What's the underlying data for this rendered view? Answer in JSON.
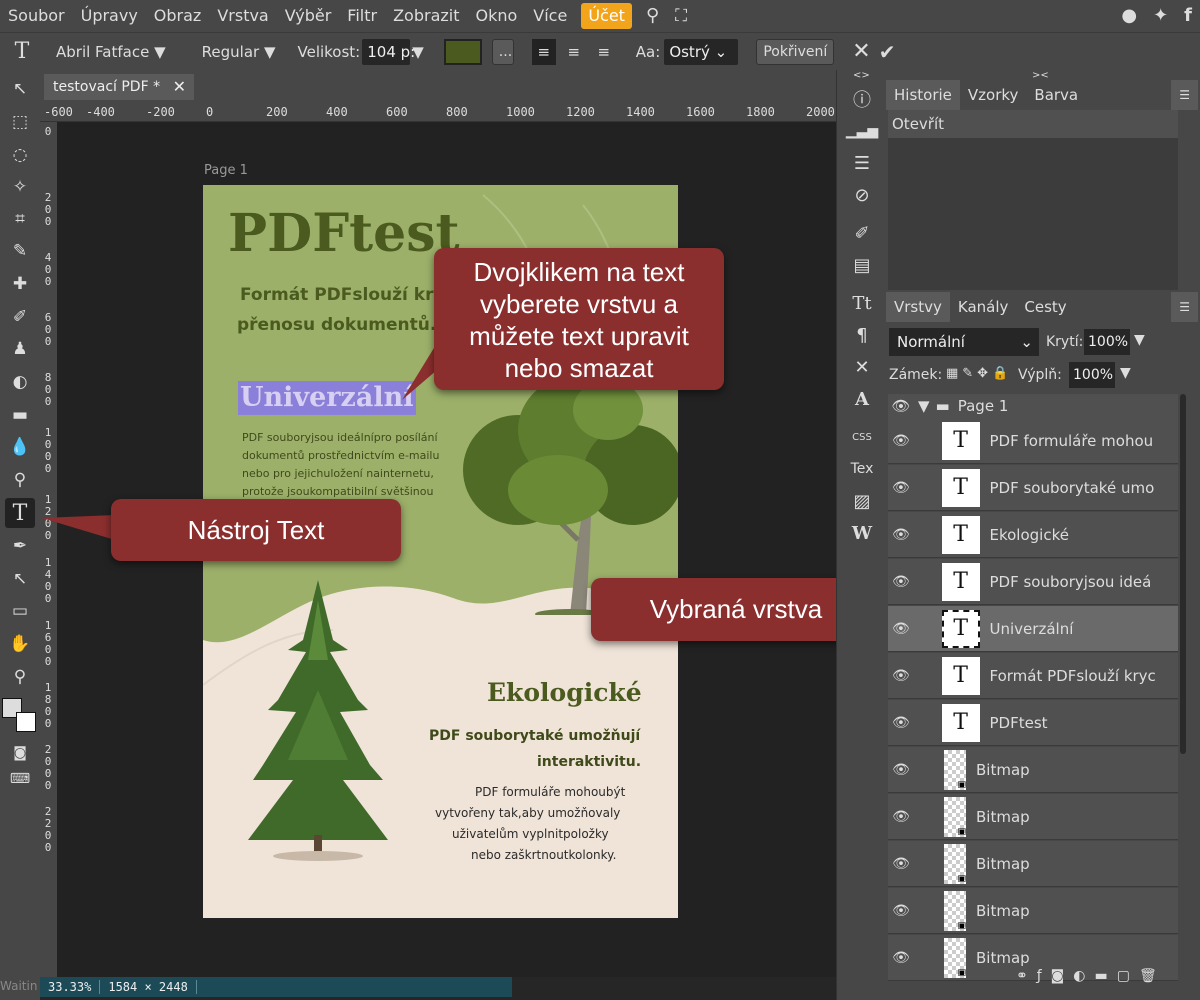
{
  "menu": {
    "items": [
      "Soubor",
      "Úpravy",
      "Obraz",
      "Vrstva",
      "Výběr",
      "Filtr",
      "Zobrazit",
      "Okno",
      "Více"
    ],
    "account": "Účet"
  },
  "options": {
    "font_family": "Abril Fatface",
    "font_style": "Regular",
    "size_label": "Velikost:",
    "size_value": "104 p:",
    "color": "#4b5a1e",
    "more": "...",
    "aa_label": "Aa:",
    "aa_value": "Ostrý",
    "advanced": "Pokřivení"
  },
  "document": {
    "tab_title": "testovací PDF *",
    "page_label": "Page 1"
  },
  "ruler": {
    "h": [
      "-600",
      "-400",
      "-200",
      "0",
      "200",
      "400",
      "600",
      "800",
      "1000",
      "1200",
      "1400",
      "1600",
      "1800",
      "2000"
    ],
    "v": [
      "0",
      "200",
      "400",
      "600",
      "800",
      "1000",
      "1200",
      "1400",
      "1600",
      "1800",
      "2000",
      "2200"
    ]
  },
  "page": {
    "title": "PDFtest",
    "subtitle_1": "Formát PDFslouží kryc",
    "subtitle_2": "přenosu dokumentů.",
    "selected_heading": "Univerzální",
    "body": [
      "PDF souboryjsou ideálnípro posílání",
      "dokumentů prostřednictvím e-mailu",
      "nebo pro jejichuložení nainternetu,",
      "protože jsoukompatibilní světšinou"
    ],
    "eco_heading": "Ekologické",
    "eco_sub_1": "PDF souborytaké umožňují",
    "eco_sub_2": "interaktivitu.",
    "eco_body": [
      "PDF formuláře mohoubýt",
      "vytvořeny tak,aby umožňovaly",
      "uživatelům vyplnitpoložky",
      "nebo zaškrtnoutkolonky."
    ]
  },
  "callouts": {
    "double_click_1": "Dvojklikem na text",
    "double_click_2": "vyberete vrstvu a",
    "double_click_3": "můžete text upravit",
    "double_click_4": "nebo smazat",
    "text_tool": "Nástroj Text",
    "selected_layer": "Vybraná vrstva"
  },
  "side_icons": {
    "css": "CSS",
    "tex": "Tex"
  },
  "history": {
    "tabs": [
      "Historie",
      "Vzorky",
      "Barva"
    ],
    "items": [
      "Otevřít"
    ]
  },
  "layers_panel": {
    "tabs": [
      "Vrstvy",
      "Kanály",
      "Cesty"
    ],
    "blend_mode": "Normální",
    "opacity_label": "Krytí:",
    "opacity_value": "100%",
    "lock_label": "Zámek:",
    "fill_label": "Výplň:",
    "fill_value": "100%",
    "group": "Page 1",
    "layers": [
      {
        "name": "PDF formuláře mohou",
        "type": "text",
        "selected": false
      },
      {
        "name": "PDF souborytaké umo",
        "type": "text",
        "selected": false
      },
      {
        "name": "Ekologické",
        "type": "text",
        "selected": false
      },
      {
        "name": "PDF souboryjsou ideá",
        "type": "text",
        "selected": false
      },
      {
        "name": "Univerzální",
        "type": "text",
        "selected": true
      },
      {
        "name": "Formát PDFslouží kryc",
        "type": "text",
        "selected": false
      },
      {
        "name": "PDFtest",
        "type": "text",
        "selected": false
      },
      {
        "name": "Bitmap",
        "type": "bitmap",
        "selected": false
      },
      {
        "name": "Bitmap",
        "type": "bitmap",
        "selected": false
      },
      {
        "name": "Bitmap",
        "type": "bitmap",
        "selected": false
      },
      {
        "name": "Bitmap",
        "type": "bitmap",
        "selected": false
      },
      {
        "name": "Bitmap",
        "type": "bitmap",
        "selected": false
      }
    ]
  },
  "status": {
    "zoom": "33.33%",
    "dimensions": "1584 × 2448",
    "left_text": "Waitin"
  },
  "colors": {
    "accent": "#f2a51a",
    "callout": "#8b2e2e",
    "page_green": "#9cb06a",
    "title_green": "#4b5a1e",
    "selection": "#8b80d9"
  }
}
